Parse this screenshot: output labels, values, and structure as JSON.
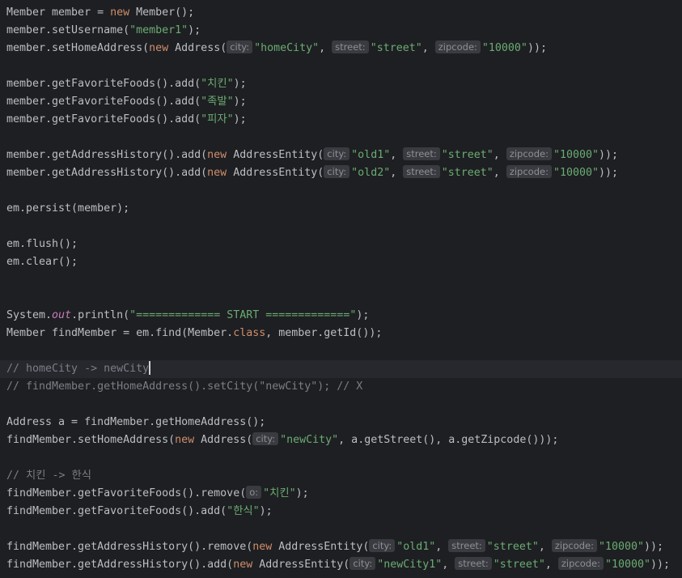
{
  "editor": {
    "lines": [
      {
        "segments": [
          {
            "t": "Member member = ",
            "c": "p"
          },
          {
            "t": "new",
            "c": "kw"
          },
          {
            "t": " Member();",
            "c": "p"
          }
        ]
      },
      {
        "segments": [
          {
            "t": "member.setUsername(",
            "c": "p"
          },
          {
            "t": "\"member1\"",
            "c": "str"
          },
          {
            "t": ");",
            "c": "p"
          }
        ]
      },
      {
        "segments": [
          {
            "t": "member.setHomeAddress(",
            "c": "p"
          },
          {
            "t": "new",
            "c": "kw"
          },
          {
            "t": " Address(",
            "c": "p"
          },
          {
            "t": "city:",
            "c": "hint"
          },
          {
            "t": "\"homeCity\"",
            "c": "str"
          },
          {
            "t": ", ",
            "c": "p"
          },
          {
            "t": "street:",
            "c": "hint"
          },
          {
            "t": "\"street\"",
            "c": "str"
          },
          {
            "t": ", ",
            "c": "p"
          },
          {
            "t": "zipcode:",
            "c": "hint"
          },
          {
            "t": "\"10000\"",
            "c": "str"
          },
          {
            "t": "));",
            "c": "p"
          }
        ]
      },
      {
        "segments": []
      },
      {
        "segments": [
          {
            "t": "member.getFavoriteFoods().add(",
            "c": "p"
          },
          {
            "t": "\"치킨\"",
            "c": "str"
          },
          {
            "t": ");",
            "c": "p"
          }
        ]
      },
      {
        "segments": [
          {
            "t": "member.getFavoriteFoods().add(",
            "c": "p"
          },
          {
            "t": "\"족발\"",
            "c": "str"
          },
          {
            "t": ");",
            "c": "p"
          }
        ]
      },
      {
        "segments": [
          {
            "t": "member.getFavoriteFoods().add(",
            "c": "p"
          },
          {
            "t": "\"피자\"",
            "c": "str"
          },
          {
            "t": ");",
            "c": "p"
          }
        ]
      },
      {
        "segments": []
      },
      {
        "segments": [
          {
            "t": "member.getAddressHistory().add(",
            "c": "p"
          },
          {
            "t": "new",
            "c": "kw"
          },
          {
            "t": " AddressEntity(",
            "c": "p"
          },
          {
            "t": "city:",
            "c": "hint"
          },
          {
            "t": "\"old1\"",
            "c": "str"
          },
          {
            "t": ", ",
            "c": "p"
          },
          {
            "t": "street:",
            "c": "hint"
          },
          {
            "t": "\"street\"",
            "c": "str"
          },
          {
            "t": ", ",
            "c": "p"
          },
          {
            "t": "zipcode:",
            "c": "hint"
          },
          {
            "t": "\"10000\"",
            "c": "str"
          },
          {
            "t": "));",
            "c": "p"
          }
        ]
      },
      {
        "segments": [
          {
            "t": "member.getAddressHistory().add(",
            "c": "p"
          },
          {
            "t": "new",
            "c": "kw"
          },
          {
            "t": " AddressEntity(",
            "c": "p"
          },
          {
            "t": "city:",
            "c": "hint"
          },
          {
            "t": "\"old2\"",
            "c": "str"
          },
          {
            "t": ", ",
            "c": "p"
          },
          {
            "t": "street:",
            "c": "hint"
          },
          {
            "t": "\"street\"",
            "c": "str"
          },
          {
            "t": ", ",
            "c": "p"
          },
          {
            "t": "zipcode:",
            "c": "hint"
          },
          {
            "t": "\"10000\"",
            "c": "str"
          },
          {
            "t": "));",
            "c": "p"
          }
        ]
      },
      {
        "segments": []
      },
      {
        "segments": [
          {
            "t": "em.persist(member);",
            "c": "p"
          }
        ]
      },
      {
        "segments": []
      },
      {
        "segments": [
          {
            "t": "em.flush();",
            "c": "p"
          }
        ]
      },
      {
        "segments": [
          {
            "t": "em.clear();",
            "c": "p"
          }
        ]
      },
      {
        "segments": []
      },
      {
        "segments": []
      },
      {
        "segments": [
          {
            "t": "System.",
            "c": "p"
          },
          {
            "t": "out",
            "c": "static"
          },
          {
            "t": ".println(",
            "c": "p"
          },
          {
            "t": "\"============= START =============\"",
            "c": "str"
          },
          {
            "t": ");",
            "c": "p"
          }
        ]
      },
      {
        "segments": [
          {
            "t": "Member findMember = em.find(Member.",
            "c": "p"
          },
          {
            "t": "class",
            "c": "kw"
          },
          {
            "t": ", member.getId());",
            "c": "p"
          }
        ]
      },
      {
        "segments": []
      },
      {
        "current": true,
        "segments": [
          {
            "t": "// homeCity -> newCity",
            "c": "cmt"
          },
          {
            "t": "",
            "c": "caret"
          }
        ]
      },
      {
        "segments": [
          {
            "t": "// findMember.getHomeAddress().setCity(\"newCity\"); // X",
            "c": "cmt"
          }
        ]
      },
      {
        "segments": []
      },
      {
        "segments": [
          {
            "t": "Address a = findMember.getHomeAddress();",
            "c": "p"
          }
        ]
      },
      {
        "segments": [
          {
            "t": "findMember.setHomeAddress(",
            "c": "p"
          },
          {
            "t": "new",
            "c": "kw"
          },
          {
            "t": " Address(",
            "c": "p"
          },
          {
            "t": "city:",
            "c": "hint"
          },
          {
            "t": "\"newCity\"",
            "c": "str"
          },
          {
            "t": ", a.getStreet(), a.getZipcode()));",
            "c": "p"
          }
        ]
      },
      {
        "segments": []
      },
      {
        "segments": [
          {
            "t": "// 치킨 -> 한식",
            "c": "cmt"
          }
        ]
      },
      {
        "segments": [
          {
            "t": "findMember.getFavoriteFoods().remove(",
            "c": "p"
          },
          {
            "t": "o:",
            "c": "hint"
          },
          {
            "t": "\"치킨\"",
            "c": "str"
          },
          {
            "t": ");",
            "c": "p"
          }
        ]
      },
      {
        "segments": [
          {
            "t": "findMember.getFavoriteFoods().add(",
            "c": "p"
          },
          {
            "t": "\"한식\"",
            "c": "str"
          },
          {
            "t": ");",
            "c": "p"
          }
        ]
      },
      {
        "segments": []
      },
      {
        "segments": [
          {
            "t": "findMember.getAddressHistory().remove(",
            "c": "p"
          },
          {
            "t": "new",
            "c": "kw"
          },
          {
            "t": " AddressEntity(",
            "c": "p"
          },
          {
            "t": "city:",
            "c": "hint"
          },
          {
            "t": "\"old1\"",
            "c": "str"
          },
          {
            "t": ", ",
            "c": "p"
          },
          {
            "t": "street:",
            "c": "hint"
          },
          {
            "t": "\"street\"",
            "c": "str"
          },
          {
            "t": ", ",
            "c": "p"
          },
          {
            "t": "zipcode:",
            "c": "hint"
          },
          {
            "t": "\"10000\"",
            "c": "str"
          },
          {
            "t": "));",
            "c": "p"
          }
        ]
      },
      {
        "segments": [
          {
            "t": "findMember.getAddressHistory().add(",
            "c": "p"
          },
          {
            "t": "new",
            "c": "kw"
          },
          {
            "t": " AddressEntity(",
            "c": "p"
          },
          {
            "t": "city:",
            "c": "hint"
          },
          {
            "t": "\"newCity1\"",
            "c": "str"
          },
          {
            "t": ", ",
            "c": "p"
          },
          {
            "t": "street:",
            "c": "hint"
          },
          {
            "t": "\"street\"",
            "c": "str"
          },
          {
            "t": ", ",
            "c": "p"
          },
          {
            "t": "zipcode:",
            "c": "hint"
          },
          {
            "t": "\"10000\"",
            "c": "str"
          },
          {
            "t": "));",
            "c": "p"
          }
        ]
      }
    ]
  },
  "colors": {
    "background": "#1e1f22",
    "plain": "#bcbec4",
    "keyword": "#cf8e6d",
    "string": "#6aab73",
    "comment": "#7a7e85",
    "static_field": "#c77dbb",
    "inlay_hint_bg": "#393b40",
    "inlay_hint_fg": "#8c8f95",
    "current_line": "#26282e"
  }
}
